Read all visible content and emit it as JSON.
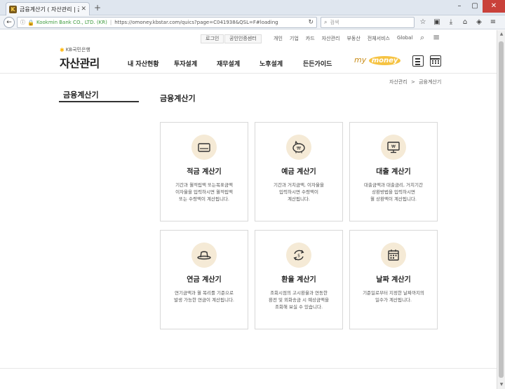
{
  "browser": {
    "tab_title": "금융계산기 ( 자산관리 | 금융",
    "url_org": "Kookmin Bank CO., LTD. (KR)",
    "url": "https://omoney.kbstar.com/quics?page=C041938&QSL=F#loading",
    "search_placeholder": "검색"
  },
  "util": {
    "login": "로그인",
    "cert_center": "공인인증센터",
    "links": [
      "개인",
      "기업",
      "카드",
      "자산관리",
      "부동산",
      "전체서비스",
      "Global"
    ]
  },
  "logo": {
    "bank": "KB국민은행",
    "title": "자산관리"
  },
  "gnb": {
    "items": [
      "내 자산현황",
      "투자설계",
      "재무설계",
      "노후설계",
      "든든가이드"
    ],
    "mymoney_a": "my",
    "mymoney_b": "money"
  },
  "breadcrumb": {
    "root": "자산관리",
    "arrow": ">",
    "current": "금융계산기"
  },
  "lnb": {
    "title": "금융계산기"
  },
  "main": {
    "title": "금융계산기",
    "cards": [
      {
        "title": "적금 계산기",
        "desc": "기간과 월적립액 또는목표금액\n이자율을 입력하시면 월적립액\n또는 수령액이 계산됩니다.",
        "icon": "passbook-icon"
      },
      {
        "title": "예금 계산기",
        "desc": "기간과 거치금액, 이자율을\n입력하시면 수령액이\n계산됩니다.",
        "icon": "piggy-bank-icon"
      },
      {
        "title": "대출 계산기",
        "desc": "대출금액과 대출금리, 거치기간\n상환방법을 입력하시면\n월 상환액이 계산됩니다.",
        "icon": "monitor-won-icon"
      },
      {
        "title": "연금 계산기",
        "desc": "연기금액과 월 복리를 기준으로\n발생 가능한 연금이 계산됩니다.",
        "icon": "hat-icon"
      },
      {
        "title": "환율 계산기",
        "desc": "조회시점의 고시환율과 연동한\n환전 및 외화송금 시 예상금액을\n조회해 보실 수 있습니다.",
        "icon": "exchange-icon"
      },
      {
        "title": "날짜 계산기",
        "desc": "기준일로부터 지정한 날짜까지의\n일수가 계산됩니다.",
        "icon": "calendar-icon"
      }
    ]
  }
}
